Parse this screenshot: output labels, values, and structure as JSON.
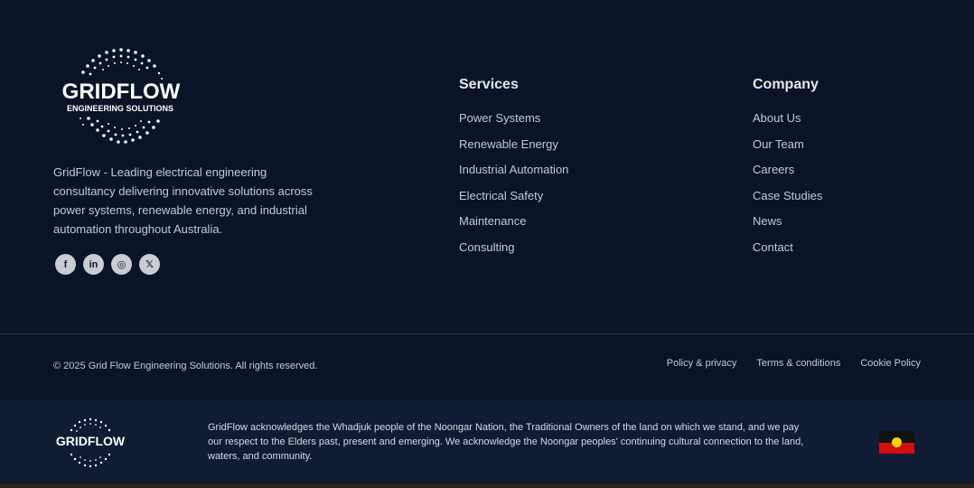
{
  "brand": {
    "name": "GRIDFLOW",
    "tagline": "ENGINEERING SOLUTIONS",
    "description": "GridFlow - Leading electrical engineering consultancy delivering innovative solutions across power systems, renewable energy, and industrial automation throughout Australia."
  },
  "socials": [
    {
      "icon": "facebook-icon",
      "glyph": "f"
    },
    {
      "icon": "linkedin-icon",
      "glyph": "in"
    },
    {
      "icon": "instagram-icon",
      "glyph": "◎"
    },
    {
      "icon": "x-icon",
      "glyph": "𝕏"
    }
  ],
  "services": {
    "title": "Services",
    "links": [
      "Power Systems",
      "Renewable Energy",
      "Industrial Automation",
      "Electrical Safety",
      "Maintenance",
      "Consulting"
    ]
  },
  "company": {
    "title": "Company",
    "links": [
      "About Us",
      "Our Team",
      "Careers",
      "Case Studies",
      "News",
      "Contact"
    ]
  },
  "bottom": {
    "copyright": "© 2025 Grid Flow Engineering Solutions. All rights reserved.",
    "legal": [
      "Policy & privacy",
      "Terms & conditions",
      "Cookie Policy"
    ]
  },
  "acknowledgement": {
    "logo_text": "GRIDFLOW",
    "text": "GridFlow acknowledges the Whadjuk people of the Noongar Nation, the  Traditional Owners of the land on which we stand, and we pay our respect to the Elders past, present and emerging. We acknowledge the Noongar  peoples' continuing cultural connection to the land, waters, and  community."
  },
  "colors": {
    "background": "#0a1428",
    "ack_background": "#0f1c33",
    "text": "#c4c9d3",
    "heading": "#e4e7ee"
  }
}
